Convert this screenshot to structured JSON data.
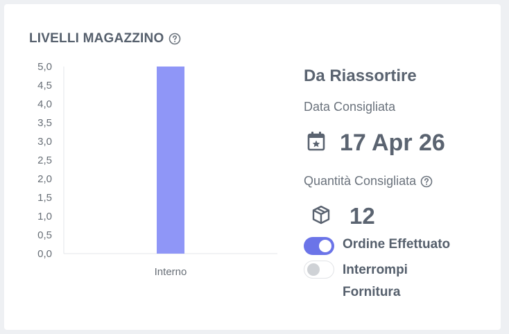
{
  "card": {
    "title": "LIVELLI MAGAZZINO"
  },
  "chart_data": {
    "type": "bar",
    "categories": [
      "Interno"
    ],
    "values": [
      5.0
    ],
    "ylim": [
      0,
      5
    ],
    "yticks": [
      "0,0",
      "0,5",
      "1,0",
      "1,5",
      "2,0",
      "2,5",
      "3,0",
      "3,5",
      "4,0",
      "4,5",
      "5,0"
    ],
    "bar_color": "#8f96f7",
    "grid": false
  },
  "restock": {
    "heading": "Da Riassortire",
    "date_label": "Data Consigliata",
    "date_value": "17 Apr 26",
    "qty_label": "Quantità Consigliata",
    "qty_value": "12"
  },
  "toggles": [
    {
      "label": "Ordine Effettuato",
      "on": true
    },
    {
      "label": "Interrompi Fornitura",
      "on": false
    }
  ],
  "colors": {
    "accent": "#6b74e8",
    "text": "#555f6c"
  },
  "icons": {
    "title_help": "help-circle-icon",
    "date": "calendar-star-icon",
    "qty_help": "help-circle-icon",
    "qty": "package-box-icon"
  }
}
